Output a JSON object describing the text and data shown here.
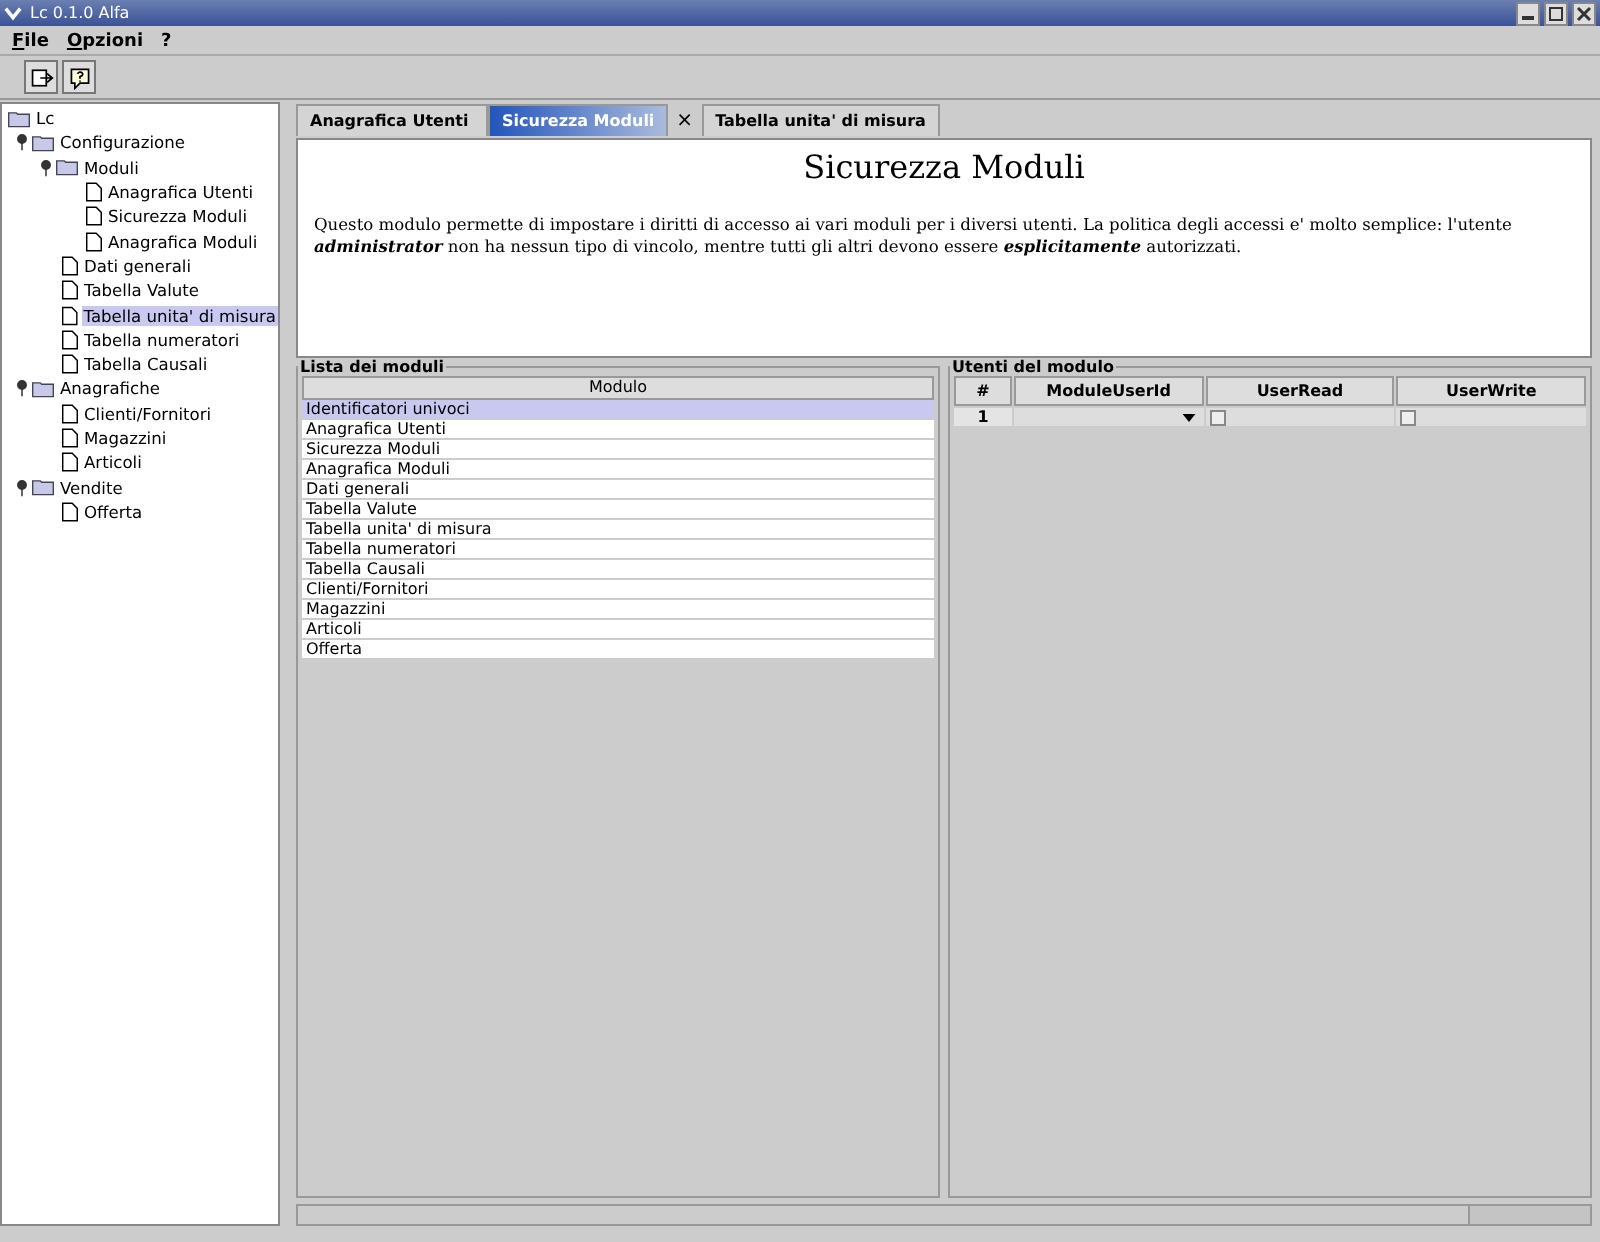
{
  "window": {
    "title": "Lc 0.1.0 Alfa"
  },
  "menu": [
    "File",
    "Opzioni",
    "?"
  ],
  "tree": [
    {
      "label": "Lc",
      "kind": "root",
      "children": [
        {
          "label": "Configurazione",
          "kind": "folder",
          "expanded": true,
          "children": [
            {
              "label": "Moduli",
              "kind": "folder",
              "expanded": true,
              "children": [
                {
                  "label": "Anagrafica Utenti",
                  "kind": "doc",
                  "selected": false
                },
                {
                  "label": "Sicurezza Moduli",
                  "kind": "doc",
                  "selected": false
                },
                {
                  "label": "Anagrafica Moduli",
                  "kind": "doc",
                  "selected": false
                }
              ]
            },
            {
              "label": "Dati generali",
              "kind": "doc",
              "selected": false
            },
            {
              "label": "Tabella Valute",
              "kind": "doc",
              "selected": false
            },
            {
              "label": "Tabella unita' di misura",
              "kind": "doc",
              "selected": true
            },
            {
              "label": "Tabella numeratori",
              "kind": "doc",
              "selected": false
            },
            {
              "label": "Tabella Causali",
              "kind": "doc",
              "selected": false
            }
          ]
        },
        {
          "label": "Anagrafiche",
          "kind": "folder",
          "expanded": true,
          "children": [
            {
              "label": "Clienti/Fornitori",
              "kind": "doc",
              "selected": false
            },
            {
              "label": "Magazzini",
              "kind": "doc",
              "selected": false
            },
            {
              "label": "Articoli",
              "kind": "doc",
              "selected": false
            }
          ]
        },
        {
          "label": "Vendite",
          "kind": "folder",
          "expanded": true,
          "children": [
            {
              "label": "Offerta",
              "kind": "doc",
              "selected": false
            }
          ]
        }
      ]
    }
  ],
  "tabs": [
    {
      "label": "Anagrafica Utenti",
      "selected": false
    },
    {
      "label": "Sicurezza Moduli",
      "selected": true,
      "close": "×"
    },
    {
      "label": "Tabella unita' di misura",
      "selected": false
    }
  ],
  "page": {
    "title": "Sicurezza Moduli",
    "description": "Questo modulo permette di impostare i diritti di accesso ai vari moduli per i diversi utenti. La politica degli accessi e' molto semplice: l'utente **administrator** non ha nessun tipo di vincolo, mentre tutti gli altri devono essere **esplicitamente** autorizzati."
  },
  "modules": {
    "title": "Lista dei moduli",
    "column": "Modulo",
    "rows": [
      {
        "label": "Identificatori univoci",
        "selected": true
      },
      {
        "label": "Anagrafica Utenti",
        "selected": false
      },
      {
        "label": "Sicurezza Moduli",
        "selected": false
      },
      {
        "label": "Anagrafica Moduli",
        "selected": false
      },
      {
        "label": "Dati generali",
        "selected": false
      },
      {
        "label": "Tabella Valute",
        "selected": false
      },
      {
        "label": "Tabella unita' di misura",
        "selected": false
      },
      {
        "label": "Tabella numeratori",
        "selected": false
      },
      {
        "label": "Tabella Causali",
        "selected": false
      },
      {
        "label": "Clienti/Fornitori",
        "selected": false
      },
      {
        "label": "Magazzini",
        "selected": false
      },
      {
        "label": "Articoli",
        "selected": false
      },
      {
        "label": "Offerta",
        "selected": false
      }
    ]
  },
  "users": {
    "title": "Utenti del modulo",
    "columns": [
      "#",
      "ModuleUserId",
      "UserRead",
      "UserWrite"
    ],
    "rows": [
      {
        "number": "1",
        "read": false,
        "write": false
      }
    ]
  }
}
